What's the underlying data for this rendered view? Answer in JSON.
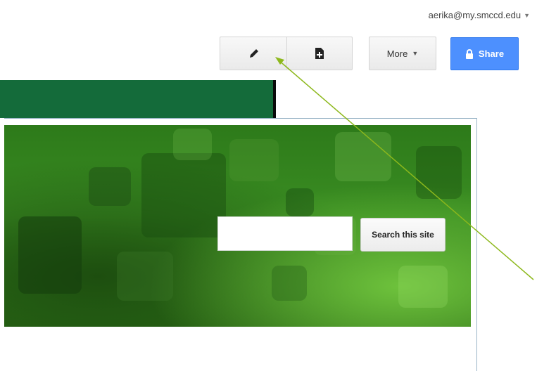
{
  "header": {
    "account_email": "aerika@my.smccd.edu",
    "account_caret_icon": "chevron-down-icon"
  },
  "toolbar": {
    "edit_icon": "pencil-icon",
    "new_page_icon": "new-page-icon",
    "more_label": "More",
    "share_label": "Share",
    "share_icon": "lock-icon",
    "share_color": "#4d90fe"
  },
  "banner": {
    "search_placeholder": "",
    "search_button_label": "Search this site",
    "dark_strip_color": "#146b3a"
  },
  "annotation": {
    "arrow_color": "#8db81c"
  }
}
